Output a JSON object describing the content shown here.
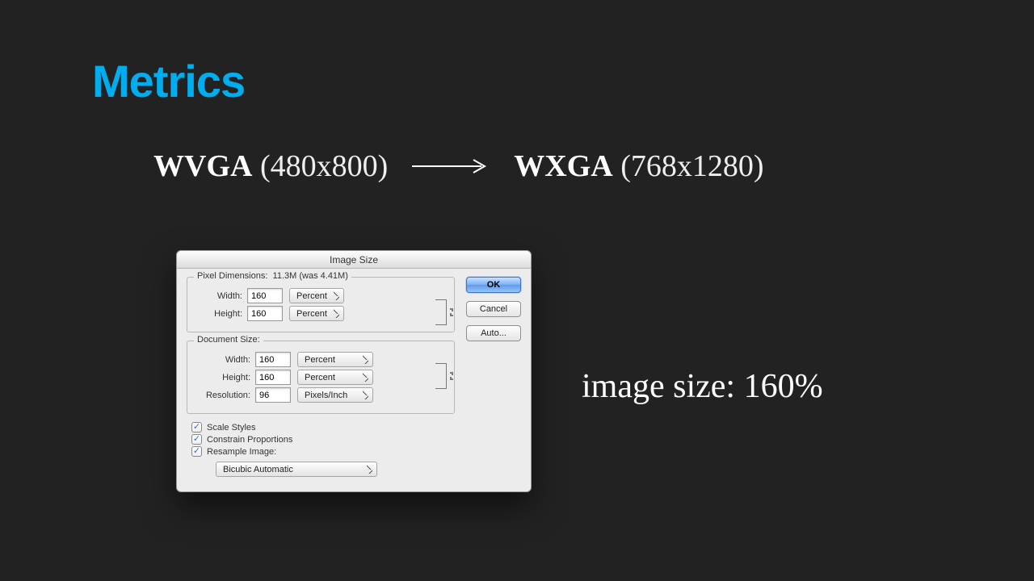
{
  "slide": {
    "title": "Metrics",
    "from_res_name": "WVGA",
    "from_res_dims": "(480x800)",
    "to_res_name": "WXGA",
    "to_res_dims": "(768x1280)",
    "caption": "image size: 160%"
  },
  "dialog": {
    "title": "Image Size",
    "pixel_legend": "Pixel Dimensions:",
    "pixel_summary": "11.3M (was 4.41M)",
    "labels": {
      "width": "Width:",
      "height": "Height:",
      "resolution": "Resolution:"
    },
    "pixel": {
      "width": "160",
      "width_unit": "Percent",
      "height": "160",
      "height_unit": "Percent"
    },
    "doc_legend": "Document Size:",
    "doc": {
      "width": "160",
      "width_unit": "Percent",
      "height": "160",
      "height_unit": "Percent",
      "resolution": "96",
      "resolution_unit": "Pixels/Inch"
    },
    "checks": {
      "scale_styles": "Scale Styles",
      "constrain": "Constrain Proportions",
      "resample": "Resample Image:"
    },
    "resample_method": "Bicubic Automatic",
    "buttons": {
      "ok": "OK",
      "cancel": "Cancel",
      "auto": "Auto..."
    }
  }
}
